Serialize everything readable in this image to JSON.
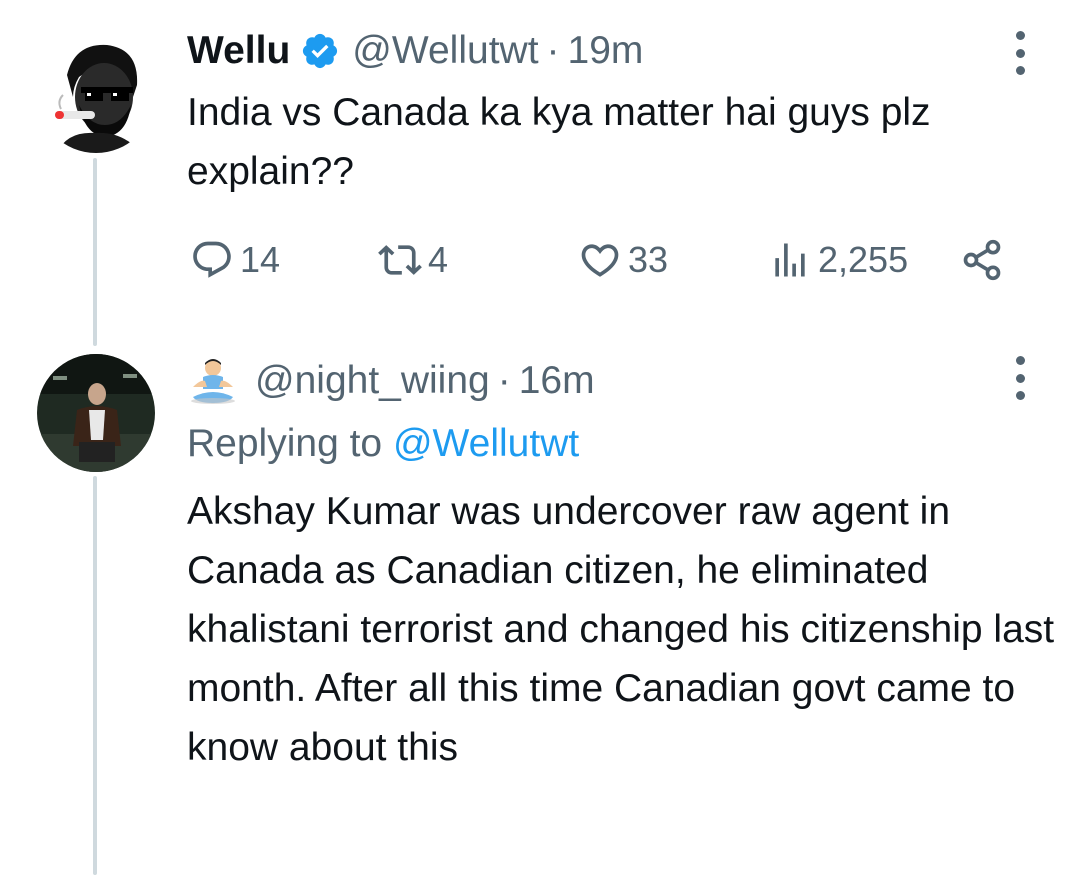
{
  "tweet": {
    "display_name": "Wellu",
    "handle": "@Wellutwt",
    "separator": "·",
    "time": "19m",
    "text": "India vs Canada ka kya matter hai guys plz explain??",
    "counts": {
      "replies": "14",
      "retweets": "4",
      "likes": "33",
      "views": "2,255"
    }
  },
  "reply": {
    "handle": "@night_wiing",
    "separator": "·",
    "time": "16m",
    "replying_label": "Replying to",
    "replying_to": "@Wellutwt",
    "text": "Akshay Kumar was undercover raw agent in Canada as Canadian citizen, he eliminated khalistani terrorist and changed his citizenship last month. After all this time Canadian govt came to know about this"
  },
  "icons": {
    "verified": "verified-badge-icon",
    "reply": "reply-icon",
    "retweet": "retweet-icon",
    "like": "heart-icon",
    "views": "views-icon",
    "share": "share-icon",
    "more": "more-options-icon"
  },
  "colors": {
    "text": "#0f1419",
    "secondary": "#536471",
    "accent": "#1d9bf0",
    "thread_line": "#cfd9de"
  }
}
